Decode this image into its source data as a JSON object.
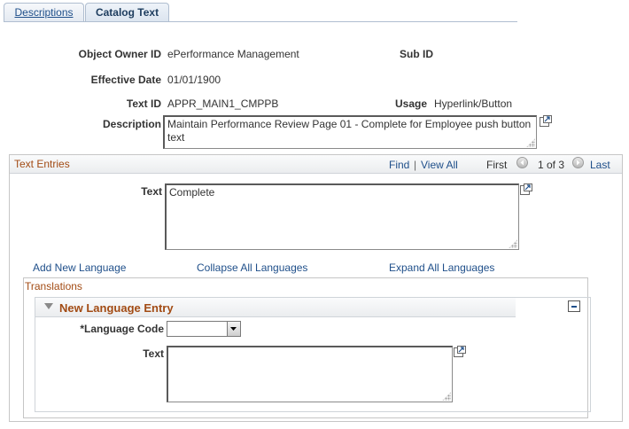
{
  "tabs": [
    {
      "label": "Descriptions",
      "active": false
    },
    {
      "label": "Catalog Text",
      "active": true
    }
  ],
  "header": {
    "object_owner_label": "Object Owner ID",
    "object_owner_value": "ePerformance Management",
    "sub_id_label": "Sub ID",
    "effective_date_label": "Effective Date",
    "effective_date_value": "01/01/1900",
    "text_id_label": "Text ID",
    "text_id_value": "APPR_MAIN1_CMPPB",
    "usage_label": "Usage",
    "usage_value": "Hyperlink/Button",
    "description_label": "Description",
    "description_value": "Maintain Performance Review Page 01 - Complete for Employee push button text"
  },
  "text_entries": {
    "title": "Text Entries",
    "find": "Find",
    "separator": "|",
    "view_all": "View All",
    "first": "First",
    "count": "1 of 3",
    "last": "Last",
    "text_label": "Text",
    "text_value": "Complete"
  },
  "language_links": {
    "add": "Add New Language",
    "collapse": "Collapse All Languages",
    "expand": "Expand All Languages"
  },
  "translations": {
    "title": "Translations",
    "entry_title": "New Language Entry",
    "language_code_label": "*Language Code",
    "language_code_value": "",
    "text_label": "Text",
    "text_value": ""
  },
  "colors": {
    "section_title": "#a24b14",
    "link": "#1f4f8a",
    "tab_border": "#b0bed0"
  }
}
